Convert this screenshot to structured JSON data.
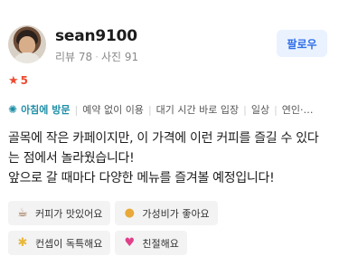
{
  "reviewer": {
    "name": "sean9100",
    "review_count": "리뷰 78",
    "photo_count": "사진 91",
    "follow_label": "팔로우"
  },
  "rating": {
    "value": "5"
  },
  "visit_tags": {
    "primary": "아침에 방문",
    "items": [
      "예약 없이 이용",
      "대기 시간 바로 입장",
      "일상",
      "연인·"
    ],
    "ellipsis": "…"
  },
  "review_text": {
    "line1": "골목에 작은 카페이지만, 이 가격에 이런 커피를 즐길 수 있다",
    "line2": "는 점에서 놀라웠습니다!",
    "line3": "앞으로 갈 때마다 다양한 메뉴를 즐겨볼 예정입니다!"
  },
  "keywords": [
    {
      "icon": "coffee-cup-icon",
      "label": "커피가 맛있어요"
    },
    {
      "icon": "money-bag-icon",
      "label": "가성비가 좋아요"
    },
    {
      "icon": "light-bulb-icon",
      "label": "컨셉이 독특해요"
    },
    {
      "icon": "heart-icon",
      "label": "친절해요"
    }
  ],
  "colors": {
    "accent_blue": "#2f6fe8",
    "rating_red": "#ec4b2f",
    "tag_teal": "#1f8fa8"
  }
}
